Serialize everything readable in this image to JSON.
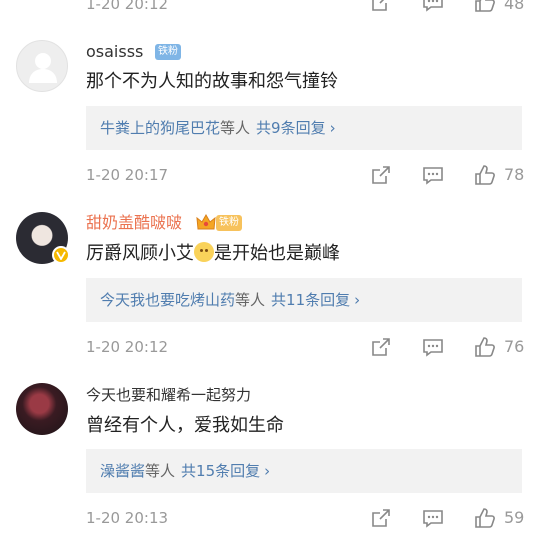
{
  "top_row": {
    "time": "1-20 20:12",
    "likes": "48"
  },
  "comments": [
    {
      "username": "osaisss",
      "fan_badge": "铁粉",
      "text": "那个不为人知的故事和怨气撞铃",
      "reply_name": "牛粪上的狗尾巴花",
      "reply_suffix": "等人",
      "reply_count": "共9条回复",
      "time": "1-20 20:17",
      "likes": "78"
    },
    {
      "username": "甜奶盖酷啵啵",
      "fan_badge": "铁粉",
      "text_before": "厉爵风顾小艾",
      "text_after": "是开始也是巅峰",
      "reply_name": "今天我也要吃烤山药",
      "reply_suffix": "等人",
      "reply_count": "共11条回复",
      "time": "1-20 20:12",
      "likes": "76"
    },
    {
      "username": "今天也要和耀希一起努力",
      "text": "曾经有个人，爱我如生命",
      "reply_name": "澡酱酱",
      "reply_suffix": "等人",
      "reply_count": "共15条回复",
      "time": "1-20 20:13",
      "likes": "59"
    }
  ],
  "colors": {
    "link": "#507daf",
    "vip_name": "#eb7350",
    "meta": "#999999",
    "reply_bg": "#f2f2f2"
  },
  "icons": [
    "share-icon",
    "comment-icon",
    "like-icon",
    "chevron-right-icon",
    "vip-crown-icon",
    "verified-badge-icon"
  ]
}
